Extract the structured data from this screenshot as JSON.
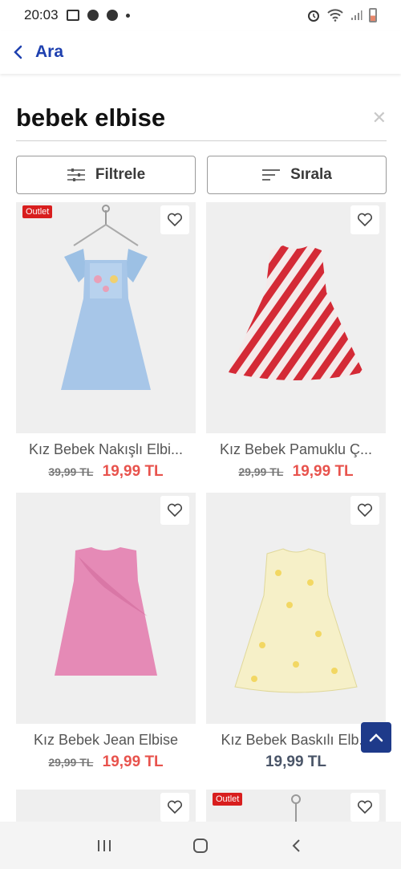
{
  "status_bar": {
    "time": "20:03"
  },
  "header": {
    "back_label": "Ara"
  },
  "search": {
    "query": "bebek elbise"
  },
  "toolbar": {
    "filter_label": "Filtrele",
    "sort_label": "Sırala"
  },
  "colors": {
    "accent": "#1e40af",
    "sale_price": "#e8534d",
    "outlet_badge": "#d81e1e"
  },
  "products": [
    {
      "name": "Kız Bebek Nakışlı Elbi...",
      "old_price": "39,99 TL",
      "price": "19,99 TL",
      "badge": "Outlet"
    },
    {
      "name": "Kız Bebek Pamuklu Ç...",
      "old_price": "29,99 TL",
      "price": "19,99 TL",
      "badge": ""
    },
    {
      "name": "Kız Bebek Jean Elbise",
      "old_price": "29,99 TL",
      "price": "19,99 TL",
      "badge": ""
    },
    {
      "name": "Kız Bebek Baskılı Elb...",
      "old_price": "",
      "price": "19,99 TL",
      "badge": ""
    },
    {
      "name": "",
      "old_price": "",
      "price": "",
      "badge": ""
    },
    {
      "name": "",
      "old_price": "",
      "price": "",
      "badge": "Outlet"
    }
  ]
}
